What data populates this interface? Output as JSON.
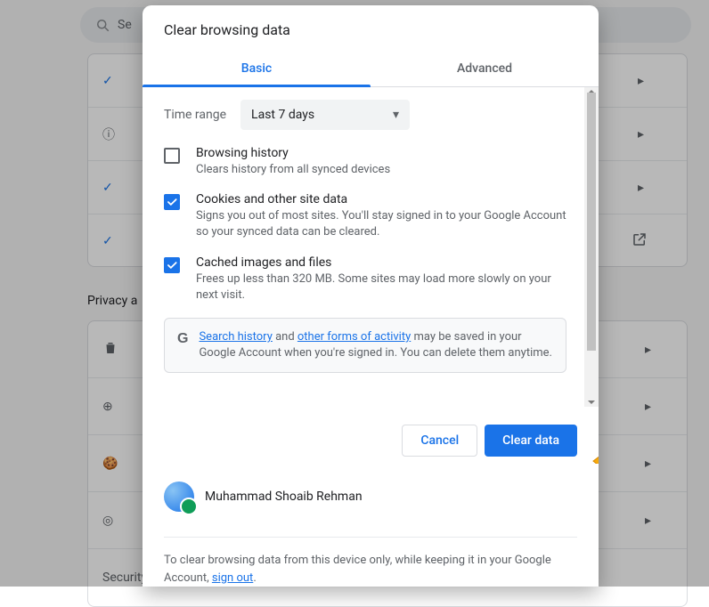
{
  "background": {
    "search_placeholder": "Se",
    "section_title": "Privacy a",
    "panel2": {
      "security_label": "Security"
    }
  },
  "dialog": {
    "title": "Clear browsing data",
    "tabs": {
      "basic": "Basic",
      "advanced": "Advanced"
    },
    "range_label": "Time range",
    "range_value": "Last 7 days",
    "items": {
      "history": {
        "title": "Browsing history",
        "desc": "Clears history from all synced devices",
        "checked": false
      },
      "cookies": {
        "title": "Cookies and other site data",
        "desc": "Signs you out of most sites. You'll stay signed in to your Google Account so your synced data can be cleared.",
        "checked": true
      },
      "cache": {
        "title": "Cached images and files",
        "desc": "Frees up less than 320 MB. Some sites may load more slowly on your next visit.",
        "checked": true
      }
    },
    "info": {
      "a1": "Search history",
      "mid": " and ",
      "a2": "other forms of activity",
      "rest": " may be saved in your Google Account when you're signed in. You can delete them anytime."
    },
    "actions": {
      "cancel": "Cancel",
      "clear": "Clear data"
    },
    "user_name": "Muhammad Shoaib Rehman",
    "note_pre": "To clear browsing data from this device only, while keeping it in your Google Account, ",
    "note_link": "sign out",
    "note_post": "."
  }
}
